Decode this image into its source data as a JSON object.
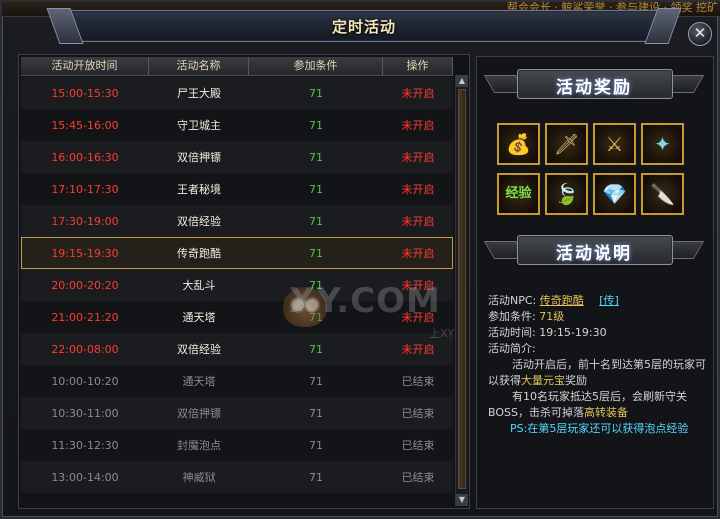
{
  "top_ticker": "帮会会长 · 鲸鲨荣誉 · 参与建设 · 领奖  挖矿",
  "window": {
    "title": "定时活动",
    "close_glyph": "✕"
  },
  "table": {
    "headers": [
      "活动开放时间",
      "活动名称",
      "参加条件",
      "操作"
    ],
    "rows": [
      {
        "time": "15:00-15:30",
        "name": "尸王大殿",
        "req": "71",
        "status": "未开启",
        "state": "open"
      },
      {
        "time": "15:45-16:00",
        "name": "守卫城主",
        "req": "71",
        "status": "未开启",
        "state": "open"
      },
      {
        "time": "16:00-16:30",
        "name": "双倍押镖",
        "req": "71",
        "status": "未开启",
        "state": "open"
      },
      {
        "time": "17:10-17:30",
        "name": "王者秘境",
        "req": "71",
        "status": "未开启",
        "state": "open"
      },
      {
        "time": "17:30-19:00",
        "name": "双倍经验",
        "req": "71",
        "status": "未开启",
        "state": "open"
      },
      {
        "time": "19:15-19:30",
        "name": "传奇跑酷",
        "req": "71",
        "status": "未开启",
        "state": "open",
        "selected": true
      },
      {
        "time": "20:00-20:20",
        "name": "大乱斗",
        "req": "71",
        "status": "未开启",
        "state": "open"
      },
      {
        "time": "21:00-21:20",
        "name": "通天塔",
        "req": "71",
        "status": "未开启",
        "state": "open"
      },
      {
        "time": "22:00-08:00",
        "name": "双倍经验",
        "req": "71",
        "status": "未开启",
        "state": "open"
      },
      {
        "time": "10:00-10:20",
        "name": "通天塔",
        "req": "71",
        "status": "已结束",
        "state": "done"
      },
      {
        "time": "10:30-11:00",
        "name": "双倍押镖",
        "req": "71",
        "status": "已结束",
        "state": "done"
      },
      {
        "time": "11:30-12:30",
        "name": "封魔泡点",
        "req": "71",
        "status": "已结束",
        "state": "done"
      },
      {
        "time": "13:00-14:00",
        "name": "神威狱",
        "req": "71",
        "status": "已结束",
        "state": "done"
      }
    ]
  },
  "watermark": {
    "text": "XY.COM",
    "sub": "上XY"
  },
  "rewards": {
    "title": "活动奖励",
    "items": [
      {
        "icon": "gold-ingot-icon",
        "glyph": "💰",
        "color": "#f5c542"
      },
      {
        "icon": "sword-icon",
        "glyph": "🗡",
        "color": "#d9c07a"
      },
      {
        "icon": "crossed-blades-icon",
        "glyph": "⚔",
        "color": "#e0b45a"
      },
      {
        "icon": "fan-blade-icon",
        "glyph": "✦",
        "color": "#7fd7e6"
      },
      {
        "icon": "exp-orb-icon",
        "glyph": "经验",
        "color": "#7be04a"
      },
      {
        "icon": "green-claw-icon",
        "glyph": "🍃",
        "color": "#6bd36b"
      },
      {
        "icon": "purple-gem-icon",
        "glyph": "💎",
        "color": "#b07adf"
      },
      {
        "icon": "dagger-icon",
        "glyph": "🔪",
        "color": "#d8a04a"
      }
    ]
  },
  "description": {
    "title": "活动说明",
    "npc_label": "活动NPC:",
    "npc_name": "传奇跑酷",
    "npc_link": "[传]",
    "req_label": "参加条件:",
    "req_value": "71级",
    "time_label": "活动时间:",
    "time_value": "19:15-19:30",
    "intro_label": "活动简介:",
    "p1_a": "活动开启后，前十名到达第5层的玩家可以获得",
    "p1_hl": "大量元宝",
    "p1_b": "奖励",
    "p2_a": "有10名玩家抵达5层后，会刷新守关BOSS，击杀可掉落",
    "p2_hl": "高转装备",
    "ps": "PS:在第5层玩家还可以获得泡点经验"
  }
}
